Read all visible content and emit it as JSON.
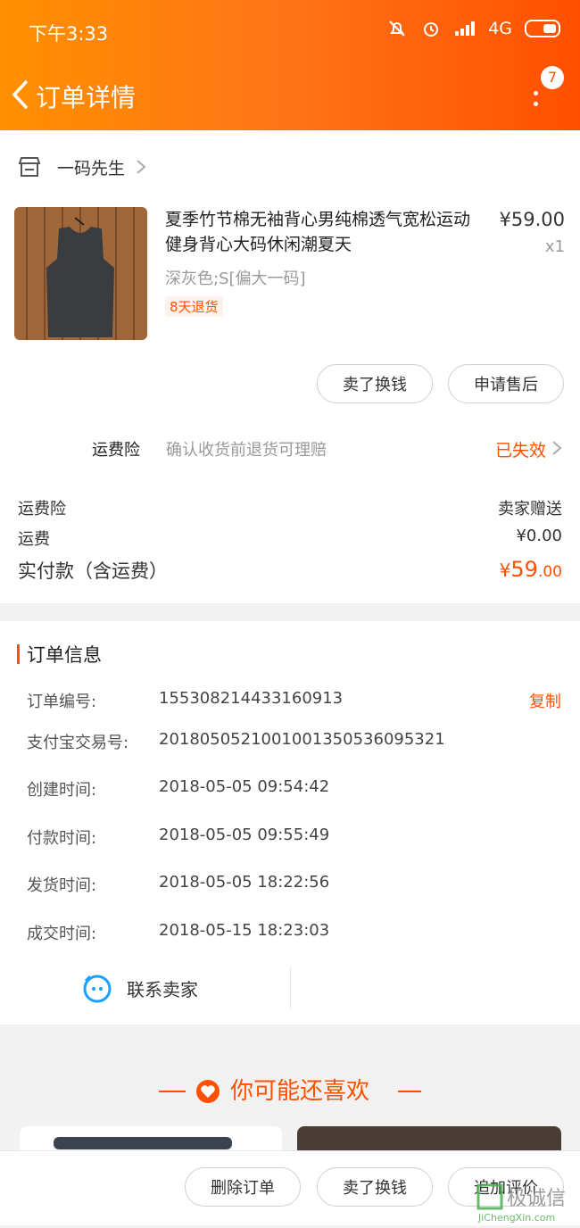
{
  "status_bar": {
    "time": "下午3:33",
    "network": "4G"
  },
  "header": {
    "title": "订单详情",
    "notification_count": "7"
  },
  "shop": {
    "name": "一码先生"
  },
  "product": {
    "title": "夏季竹节棉无袖背心男纯棉透气宽松运动健身背心大码休闲潮夏天",
    "price": "¥59.00",
    "quantity": "x1",
    "sku": "深灰色;S[偏大一码]",
    "return_tag": "8天退货"
  },
  "item_actions": {
    "sell_label": "卖了换钱",
    "after_sale_label": "申请售后"
  },
  "insurance": {
    "label": "运费险",
    "desc": "确认收货前退货可理赔",
    "status": "已失效"
  },
  "fees": {
    "rows": [
      {
        "label": "运费险",
        "value": "卖家赠送"
      },
      {
        "label": "运费",
        "value": "¥0.00"
      }
    ],
    "total_label": "实付款（含运费）",
    "total_currency": "¥",
    "total_int": "59",
    "total_dec": ".00"
  },
  "order_info": {
    "title": "订单信息",
    "copy_label": "复制",
    "rows": [
      {
        "label": "订单编号:",
        "value": "155308214433160913"
      },
      {
        "label": "支付宝交易号:",
        "value": "2018050521001001350536095321"
      },
      {
        "label": "创建时间:",
        "value": "2018-05-05 09:54:42"
      },
      {
        "label": "付款时间:",
        "value": "2018-05-05 09:55:49"
      },
      {
        "label": "发货时间:",
        "value": "2018-05-05 18:22:56"
      },
      {
        "label": "成交时间:",
        "value": "2018-05-15 18:23:03"
      }
    ],
    "contact_label": "联系卖家"
  },
  "recommend": {
    "title": "你可能还喜欢"
  },
  "bottom_actions": {
    "delete_label": "删除订单",
    "sell_label": "卖了换钱",
    "review_label": "追加评价"
  },
  "watermark": {
    "text_cn": "极诚信",
    "text_en": "JiChengXin.com"
  },
  "colors": {
    "accent": "#ff5000",
    "header_start": "#ff9000",
    "header_end": "#ff5000"
  },
  "icons": [
    "back-arrow-icon",
    "more-icon",
    "shop-icon",
    "chevron-right-icon",
    "contact-seller-icon",
    "heart-icon"
  ]
}
